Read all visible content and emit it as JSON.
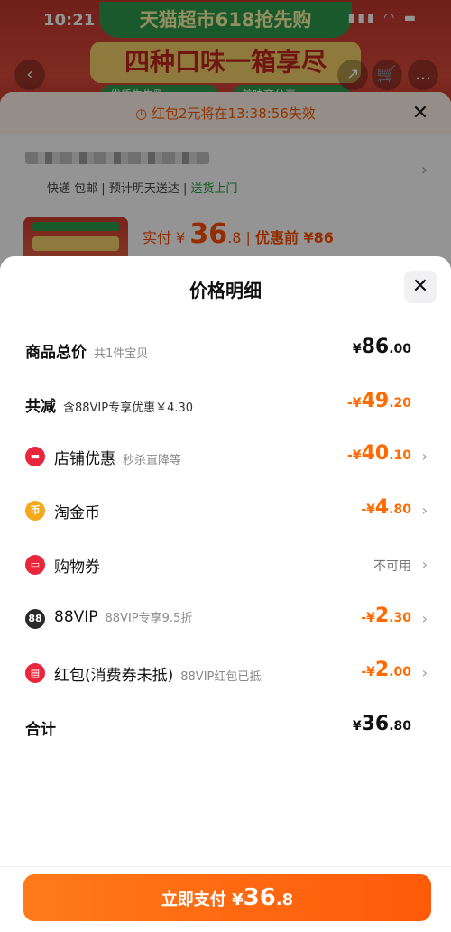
{
  "status_bar": {
    "time": "10:21",
    "signal_icons": "signal wifi battery"
  },
  "background": {
    "banner_top": "天猫超市618抢先购",
    "banner_main": "四种口味一箱享尽",
    "banner_pill_1": "优质生牛乳",
    "banner_pill_2": "美味齐分享",
    "nav": {
      "back": "‹",
      "share": "↗",
      "cart": "🛒",
      "more": "…"
    },
    "timer_text": "红包2元将在13:38:56失效",
    "timer_icon": "clock-icon",
    "close_glyph": "✕",
    "shipping": {
      "express": "快递 包邮",
      "sep": "|",
      "eta": "预计明天送达",
      "door": "送货上门"
    },
    "price": {
      "label": "实付 ¥ ",
      "int": "36",
      "dec": ".8",
      "divider": " | ",
      "before": "优惠前 ¥86"
    }
  },
  "sheet": {
    "title": "价格明细",
    "close_glyph": "✕",
    "rows": [
      {
        "label": "商品总价",
        "sub": "共1件宝贝",
        "sym": "¥",
        "int": "86",
        "dec": ".00"
      },
      {
        "label": "共减",
        "sub": "含88VIP专享优惠￥4.30",
        "sym": "-¥",
        "int": "49",
        "dec": ".20"
      },
      {
        "icon": "shop-coupon-icon",
        "label": "店铺优惠",
        "sub": "秒杀直降等",
        "sym": "-¥",
        "int": "40",
        "dec": ".10"
      },
      {
        "icon": "taojinbi-coin-icon",
        "label": "淘金币",
        "sub": "",
        "sym": "-¥",
        "int": "4",
        "dec": ".80"
      },
      {
        "icon": "shopping-voucher-icon",
        "label": "购物券",
        "sub": "",
        "status": "不可用"
      },
      {
        "icon": "88vip-icon",
        "icon_text": "88",
        "label": "88VIP",
        "sub": "88VIP专享9.5折",
        "sym": "-¥",
        "int": "2",
        "dec": ".30"
      },
      {
        "icon": "red-packet-icon",
        "label": "红包(消费券未抵)",
        "sub": "88VIP红包已抵",
        "sym": "-¥",
        "int": "2",
        "dec": ".00"
      },
      {
        "label": "合计",
        "sub": "",
        "sym": "¥",
        "int": "36",
        "dec": ".80"
      }
    ],
    "chevron": "›"
  },
  "pay_button": {
    "label": "立即支付 ¥",
    "int": "36",
    "dec": ".8"
  },
  "colors": {
    "accent": "#ff6a00",
    "brand_red": "#e8273c",
    "green": "#18a03a"
  }
}
